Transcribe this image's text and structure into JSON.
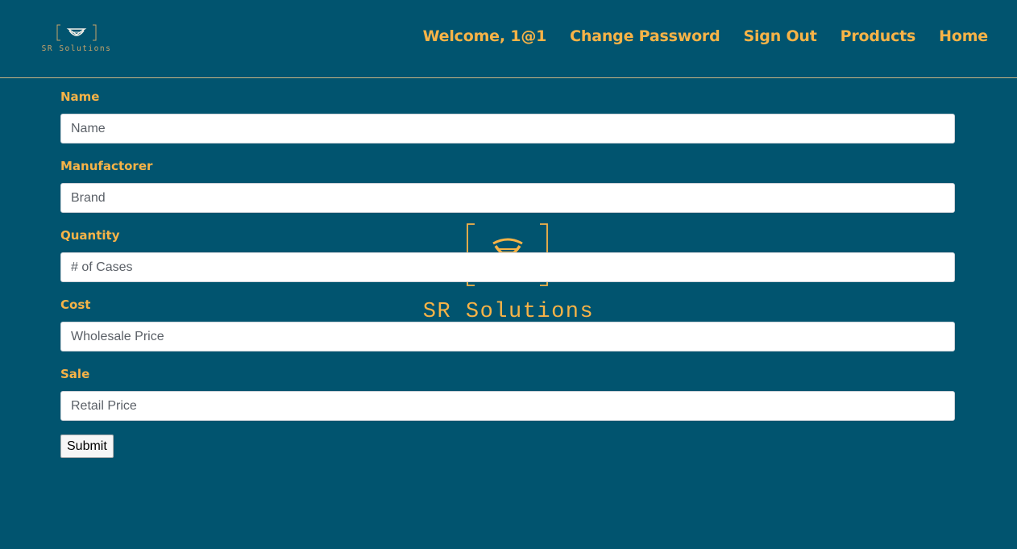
{
  "brand": {
    "name": "SR Solutions",
    "accent_color": "#f7b347",
    "background_color": "#01546f"
  },
  "nav": {
    "welcome": "Welcome, 1@1",
    "change_password": "Change Password",
    "sign_out": "Sign Out",
    "products": "Products",
    "home": "Home"
  },
  "form": {
    "fields": [
      {
        "label": "Name",
        "placeholder": "Name",
        "value": ""
      },
      {
        "label": "Manufactorer",
        "placeholder": "Brand",
        "value": ""
      },
      {
        "label": "Quantity",
        "placeholder": "# of Cases",
        "value": ""
      },
      {
        "label": "Cost",
        "placeholder": "Wholesale Price",
        "value": ""
      },
      {
        "label": "Sale",
        "placeholder": "Retail Price",
        "value": ""
      }
    ],
    "submit_label": "Submit"
  }
}
